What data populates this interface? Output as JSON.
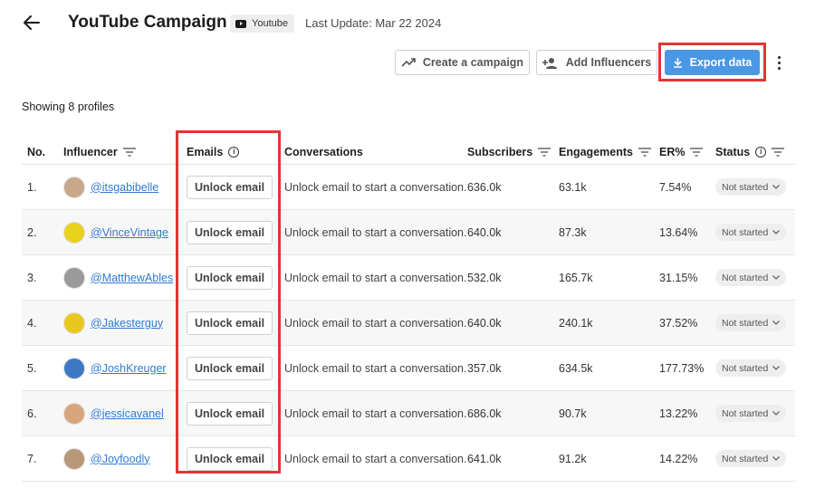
{
  "header": {
    "title": "YouTube Campaign",
    "platform": "Youtube",
    "last_update": "Last Update: Mar 22 2024"
  },
  "actions": {
    "create_campaign": "Create a campaign",
    "add_influencers": "Add Influencers",
    "export_data": "Export data"
  },
  "summary": "Showing 8 profiles",
  "columns": [
    "No.",
    "Influencer",
    "Emails",
    "Conversations",
    "Subscribers",
    "Engagements",
    "ER%",
    "Status"
  ],
  "rows": [
    {
      "no": "1.",
      "handle": "@itsgabibelle",
      "email": "Unlock email",
      "conversation": "Unlock email to start a conversation.",
      "subscribers": "636.0k",
      "engagements": "63.1k",
      "er": "7.54%",
      "status": "Not started",
      "avatar_color": "#c9a88a"
    },
    {
      "no": "2.",
      "handle": "@VinceVintage",
      "email": "Unlock email",
      "conversation": "Unlock email to start a conversation.",
      "subscribers": "640.0k",
      "engagements": "87.3k",
      "er": "13.64%",
      "status": "Not started",
      "avatar_color": "#e9d21a"
    },
    {
      "no": "3.",
      "handle": "@MatthewAbles",
      "email": "Unlock email",
      "conversation": "Unlock email to start a conversation.",
      "subscribers": "532.0k",
      "engagements": "165.7k",
      "er": "31.15%",
      "status": "Not started",
      "avatar_color": "#9a9a9a"
    },
    {
      "no": "4.",
      "handle": "@Jakesterguy",
      "email": "Unlock email",
      "conversation": "Unlock email to start a conversation.",
      "subscribers": "640.0k",
      "engagements": "240.1k",
      "er": "37.52%",
      "status": "Not started",
      "avatar_color": "#e8c81f"
    },
    {
      "no": "5.",
      "handle": "@JoshKreuger",
      "email": "Unlock email",
      "conversation": "Unlock email to start a conversation.",
      "subscribers": "357.0k",
      "engagements": "634.5k",
      "er": "177.73%",
      "status": "Not started",
      "avatar_color": "#3f78c2"
    },
    {
      "no": "6.",
      "handle": "@jessicavanel",
      "email": "Unlock email",
      "conversation": "Unlock email to start a conversation.",
      "subscribers": "686.0k",
      "engagements": "90.7k",
      "er": "13.22%",
      "status": "Not started",
      "avatar_color": "#d9a57c"
    },
    {
      "no": "7.",
      "handle": "@Joyfoodly",
      "email": "Unlock email",
      "conversation": "Unlock email to start a conversation.",
      "subscribers": "641.0k",
      "engagements": "91.2k",
      "er": "14.22%",
      "status": "Not started",
      "avatar_color": "#b89878"
    }
  ],
  "colors": {
    "accent": "#4a97e6",
    "highlight": "#e43434",
    "link": "#2f7bd4"
  },
  "icons": [
    "arrow-left-icon",
    "youtube-icon",
    "trend-up-icon",
    "add-person-icon",
    "download-icon",
    "more-vert-icon",
    "filter-icon",
    "info-icon",
    "chevron-down-icon"
  ]
}
